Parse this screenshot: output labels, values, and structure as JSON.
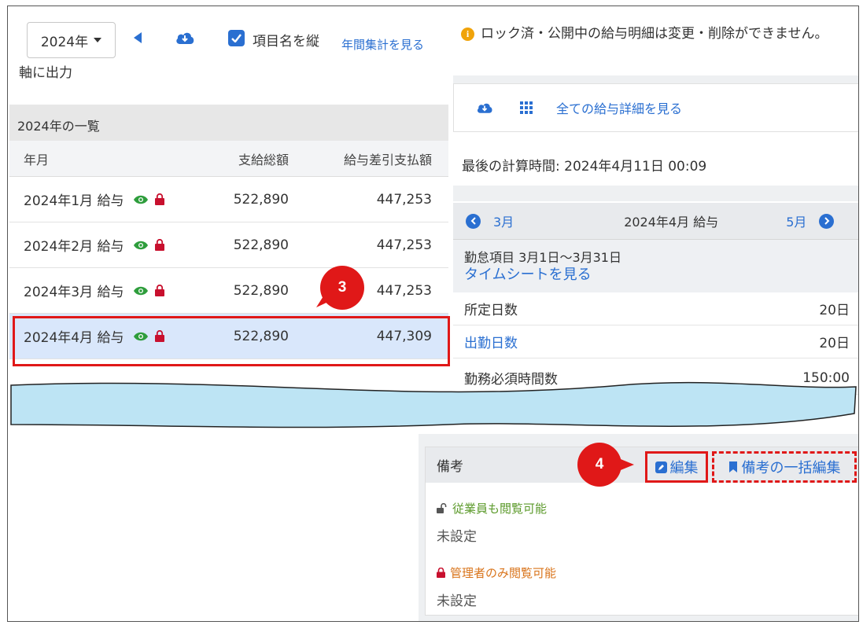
{
  "toolbar": {
    "year_label": "2024年",
    "checkbox_label_line1": "項目名を縦",
    "checkbox_label_line2": "軸に出力",
    "annual_link": "年間集計を見る"
  },
  "table": {
    "caption": "2024年の一覧",
    "headers": [
      "年月",
      "支給総額",
      "給与差引支払額"
    ],
    "rows": [
      {
        "month": "2024年1月 給与",
        "gross": "522,890",
        "net": "447,253"
      },
      {
        "month": "2024年2月 給与",
        "gross": "522,890",
        "net": "447,253"
      },
      {
        "month": "2024年3月 給与",
        "gross": "522,890",
        "net": "447,253"
      },
      {
        "month": "2024年4月 給与",
        "gross": "522,890",
        "net": "447,309"
      }
    ]
  },
  "badges": {
    "step3": "3",
    "step4": "4"
  },
  "notice": {
    "text": "ロック済・公開中の給与明細は変更・削除ができません。"
  },
  "actions": {
    "all_details_link": "全ての給与詳細を見る"
  },
  "last_calc": "最後の計算時間: 2024年4月11日 00:09",
  "period": {
    "prev_label": "3月",
    "current_label": "2024年4月 給与",
    "next_label": "5月"
  },
  "attendance": {
    "title": "勤怠項目 3月1日〜3月31日",
    "timesheet_link": "タイムシートを見る",
    "items": [
      {
        "label": "所定日数",
        "value": "20日"
      },
      {
        "label": "出勤日数",
        "value": "20日"
      },
      {
        "label": "勤務必須時間数",
        "value": "150:00"
      }
    ]
  },
  "notes": {
    "title": "備考",
    "edit_label": "編集",
    "bulk_edit_label": "備考の一括編集",
    "employee_visible_label": "従業員も閲覧可能",
    "employee_value": "未設定",
    "manager_only_label": "管理者のみ閲覧可能",
    "manager_value": "未設定"
  },
  "colors": {
    "accent": "#2a6fd1",
    "highlight_red": "#e01818",
    "eye_green": "#2e9d3c",
    "lock_red": "#c8102e",
    "selected_row": "#d9e7fb",
    "wave_fill": "#bde4f4"
  }
}
